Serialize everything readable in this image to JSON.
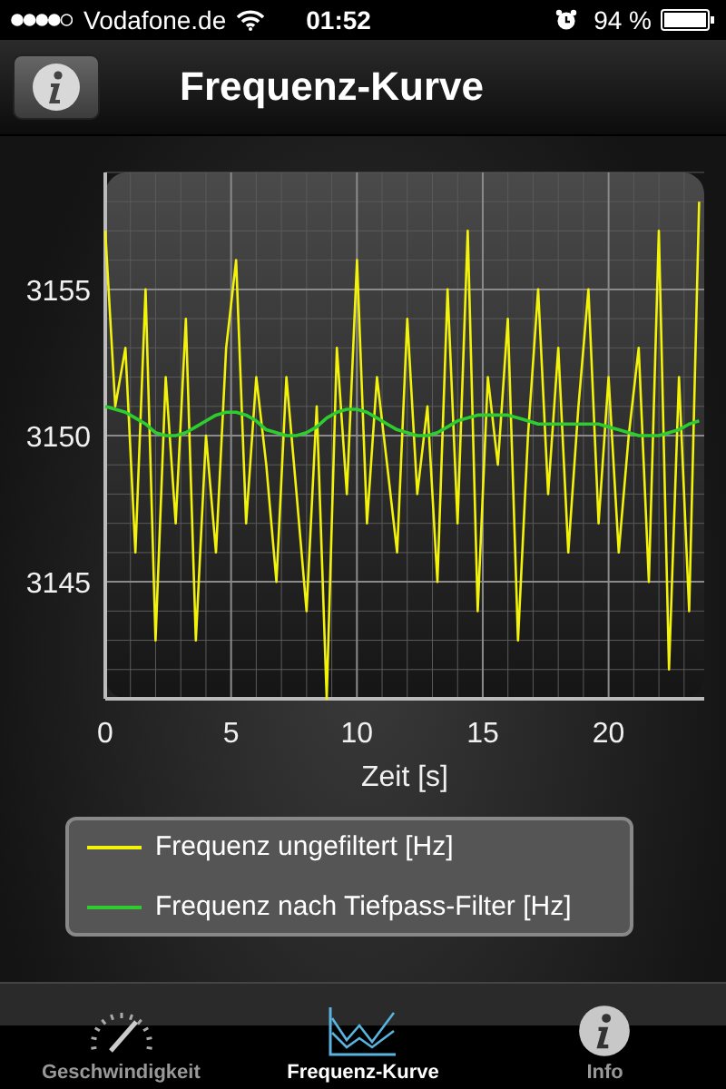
{
  "status_bar": {
    "carrier": "Vodafone.de",
    "time": "01:52",
    "battery": "94 %"
  },
  "nav_bar": {
    "title": "Frequenz-Kurve"
  },
  "chart": {
    "chart_data": {
      "type": "line",
      "grid": true,
      "xlabel": "Zeit [s]",
      "xlim": [
        0,
        23.8
      ],
      "ylim": [
        3141,
        3159
      ],
      "xticks": [
        0,
        5,
        10,
        15,
        20
      ],
      "yticks": [
        3145,
        3150,
        3155
      ],
      "x": [
        0,
        0.4,
        0.8,
        1.2,
        1.6,
        2.0,
        2.4,
        2.8,
        3.2,
        3.6,
        4.0,
        4.4,
        4.8,
        5.2,
        5.6,
        6.0,
        6.4,
        6.8,
        7.2,
        7.6,
        8.0,
        8.4,
        8.8,
        9.2,
        9.6,
        10.0,
        10.4,
        10.8,
        11.2,
        11.6,
        12.0,
        12.4,
        12.8,
        13.2,
        13.6,
        14.0,
        14.4,
        14.8,
        15.2,
        15.6,
        16.0,
        16.4,
        16.8,
        17.2,
        17.6,
        18.0,
        18.4,
        18.8,
        19.2,
        19.6,
        20.0,
        20.4,
        20.8,
        21.2,
        21.6,
        22.0,
        22.4,
        22.8,
        23.2,
        23.6
      ],
      "series": [
        {
          "name": "Frequenz ungefiltert [Hz]",
          "color": "#f2f20a",
          "values": [
            3157,
            3151,
            3153,
            3146,
            3155,
            3143,
            3152,
            3147,
            3154,
            3143,
            3150,
            3146,
            3153,
            3156,
            3147,
            3152,
            3149,
            3145,
            3152,
            3148,
            3144,
            3151,
            3141,
            3153,
            3148,
            3156,
            3147,
            3152,
            3149,
            3146,
            3154,
            3148,
            3151,
            3145,
            3155,
            3147,
            3157,
            3144,
            3152,
            3149,
            3154,
            3143,
            3150,
            3155,
            3148,
            3153,
            3146,
            3151,
            3155,
            3147,
            3152,
            3146,
            3150,
            3153,
            3145,
            3157,
            3142,
            3152,
            3144,
            3158
          ]
        },
        {
          "name": "Frequenz nach Tiefpass-Filter [Hz]",
          "color": "#2ecc2e",
          "values": [
            3151.0,
            3150.9,
            3150.8,
            3150.6,
            3150.4,
            3150.1,
            3150.0,
            3150.0,
            3150.1,
            3150.3,
            3150.5,
            3150.7,
            3150.8,
            3150.8,
            3150.7,
            3150.5,
            3150.2,
            3150.1,
            3150.0,
            3150.0,
            3150.1,
            3150.3,
            3150.6,
            3150.8,
            3150.9,
            3150.9,
            3150.8,
            3150.6,
            3150.4,
            3150.2,
            3150.1,
            3150.0,
            3150.0,
            3150.1,
            3150.3,
            3150.5,
            3150.6,
            3150.7,
            3150.7,
            3150.7,
            3150.7,
            3150.6,
            3150.5,
            3150.4,
            3150.4,
            3150.4,
            3150.4,
            3150.4,
            3150.4,
            3150.4,
            3150.3,
            3150.2,
            3150.1,
            3150.0,
            3150.0,
            3150.0,
            3150.1,
            3150.2,
            3150.4,
            3150.5
          ]
        }
      ]
    }
  },
  "tabs": [
    {
      "label": "Geschwindigkeit",
      "kind": "gauge",
      "selected": false
    },
    {
      "label": "Frequenz-Kurve",
      "kind": "chart",
      "selected": true
    },
    {
      "label": "Info",
      "kind": "info",
      "selected": false
    }
  ]
}
